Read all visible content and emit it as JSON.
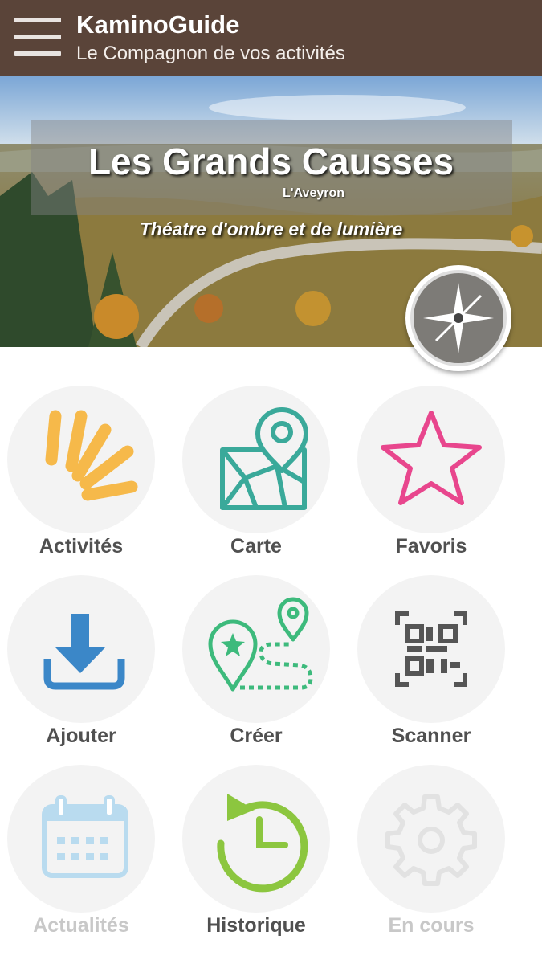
{
  "app": {
    "title": "KaminoGuide",
    "subtitle": "Le Compagnon de vos activités"
  },
  "hero": {
    "title": "Les Grands Causses",
    "region": "L'Aveyron",
    "tagline": "Théatre d'ombre et de lumière"
  },
  "colors": {
    "appbar": "#5a4439",
    "tile_circle": "#f3f3f3",
    "label": "#505050",
    "label_disabled": "#c8c8c8"
  },
  "tiles": [
    {
      "label": "Activités",
      "icon": "rays-icon",
      "color": "#f6b94a",
      "enabled": true
    },
    {
      "label": "Carte",
      "icon": "map-pin-icon",
      "color": "#3aa99a",
      "enabled": true
    },
    {
      "label": "Favoris",
      "icon": "star-icon",
      "color": "#e8468d",
      "enabled": true
    },
    {
      "label": "Ajouter",
      "icon": "download-icon",
      "color": "#3b87c8",
      "enabled": true
    },
    {
      "label": "Créer",
      "icon": "route-icon",
      "color": "#3dba7c",
      "enabled": true
    },
    {
      "label": "Scanner",
      "icon": "qr-code-icon",
      "color": "#555555",
      "enabled": true
    },
    {
      "label": "Actualités",
      "icon": "calendar-icon",
      "color": "#b9dbef",
      "enabled": false
    },
    {
      "label": "Historique",
      "icon": "history-icon",
      "color": "#8cc63f",
      "enabled": true
    },
    {
      "label": "En cours",
      "icon": "gear-icon",
      "color": "#e2e2e2",
      "enabled": false
    }
  ]
}
